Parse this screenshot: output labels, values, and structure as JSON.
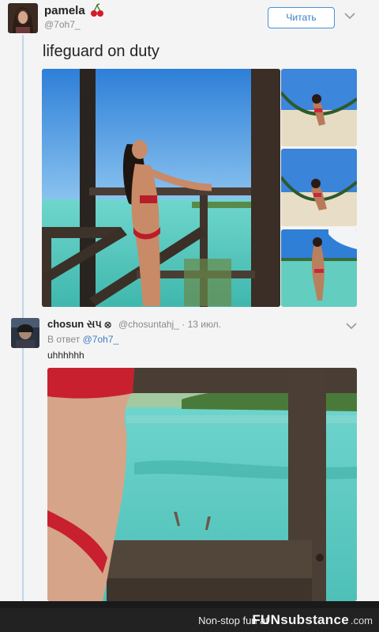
{
  "tweet1": {
    "name": "pamela",
    "handle": "@7oh7_",
    "follow_label": "Читать",
    "text": "lifeguard on duty"
  },
  "tweet2": {
    "name": "chosun સપ ⊗",
    "handle_date": "@chosuntahj_ · 13 июл.",
    "reply_prefix": "В ответ",
    "reply_to": "@7oh7_",
    "text": "uhhhhhh"
  },
  "footer": {
    "tagline": "Non-stop fun at",
    "brand_a": "FUN",
    "brand_b": "substance",
    "brand_c": ".com"
  },
  "colors": {
    "link": "#3b7fc4",
    "thread_line": "#bcd7ec",
    "sky": "#3d8be0",
    "sea": "#5fd0c4"
  }
}
